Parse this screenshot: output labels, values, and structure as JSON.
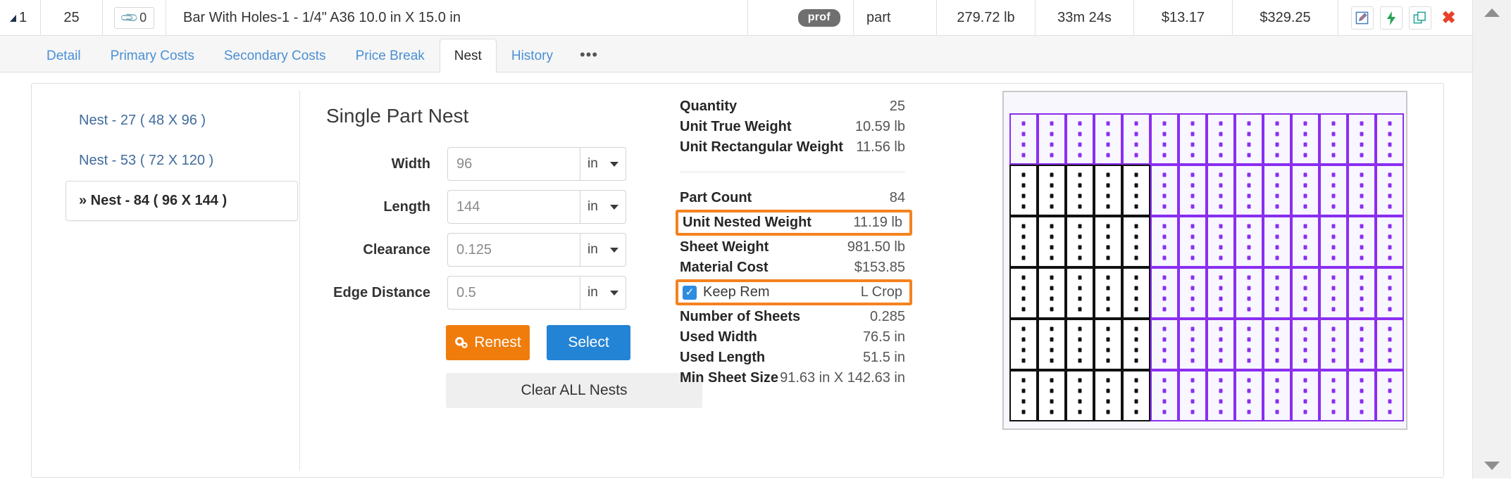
{
  "header_row": {
    "expand_icon": "caret-triangle-icon",
    "seq": "1",
    "qty": "25",
    "attachment_icon": "paperclip-icon",
    "attachment_count": "0",
    "description": "Bar With Holes-1 - 1/4\" A36 10.0 in X 15.0 in",
    "badge": "prof",
    "type": "part",
    "weight": "279.72 lb",
    "time": "33m 24s",
    "unit_cost": "$13.17",
    "total_cost": "$329.25",
    "actions": [
      {
        "name": "edit-icon",
        "glyph": "✎",
        "color": "#4a7fc1"
      },
      {
        "name": "lightning-bolt-icon",
        "glyph": "⚡",
        "color": "#23a455"
      },
      {
        "name": "duplicate-icon",
        "glyph": "⧉",
        "color": "#2fa89a"
      },
      {
        "name": "delete-icon",
        "glyph": "✖",
        "color": "#e8402a"
      }
    ]
  },
  "tabs": [
    {
      "label": "Detail",
      "active": false
    },
    {
      "label": "Primary Costs",
      "active": false
    },
    {
      "label": "Secondary Costs",
      "active": false
    },
    {
      "label": "Price Break",
      "active": false
    },
    {
      "label": "Nest",
      "active": true
    },
    {
      "label": "History",
      "active": false
    },
    {
      "label": "•••",
      "active": false
    }
  ],
  "nest_list": [
    {
      "label": "Nest - 27 ( 48 X 96 )",
      "selected": false
    },
    {
      "label": "Nest - 53 ( 72 X 120 )",
      "selected": false
    },
    {
      "label": "» Nest - 84 ( 96 X 144 )",
      "selected": true
    }
  ],
  "form": {
    "title": "Single Part Nest",
    "fields": [
      {
        "label": "Width",
        "value": "96",
        "unit": "in"
      },
      {
        "label": "Length",
        "value": "144",
        "unit": "in"
      },
      {
        "label": "Clearance",
        "value": "0.125",
        "unit": "in"
      },
      {
        "label": "Edge Distance",
        "value": "0.5",
        "unit": "in"
      }
    ],
    "renest_label": "Renest",
    "renest_icon": "gears-icon",
    "select_label": "Select",
    "clear_label": "Clear ALL Nests",
    "renest_color": "#f07c0b",
    "select_color": "#2383d4"
  },
  "stats": {
    "group1": [
      {
        "key": "Quantity",
        "value": "25"
      },
      {
        "key": "Unit True Weight",
        "value": "10.59 lb"
      },
      {
        "key": "Unit Rectangular Weight",
        "value": "11.56 lb"
      }
    ],
    "part_count": {
      "key": "Part Count",
      "value": "84"
    },
    "unit_nested_weight": {
      "key": "Unit Nested Weight",
      "value": "11.19 lb"
    },
    "sheet_weight": {
      "key": "Sheet Weight",
      "value": "981.50 lb"
    },
    "material_cost": {
      "key": "Material Cost",
      "value": "$153.85"
    },
    "keep_rem": {
      "label": "Keep Rem",
      "value": "L Crop",
      "checked": true
    },
    "group3": [
      {
        "key": "Number of Sheets",
        "value": "0.285"
      },
      {
        "key": "Used Width",
        "value": "76.5 in"
      },
      {
        "key": "Used Length",
        "value": "51.5 in"
      }
    ],
    "min_sheet_size": {
      "key": "Min Sheet Size",
      "value": "91.63 in X 142.63 in"
    },
    "highlight_color": "#f5821f"
  },
  "nest_diagram": {
    "columns": 14,
    "rows": 6,
    "holes_per_part": 4,
    "black_part_color": "#111111",
    "purple_part_color": "#8b2ef0",
    "sheet_bg": "#f7f7fd",
    "black_region": {
      "cols": [
        0,
        1,
        2,
        3,
        4
      ],
      "rows": [
        1,
        2,
        3,
        4,
        5
      ]
    }
  },
  "scrollbar": {
    "up": "scroll-up-arrow",
    "down": "scroll-down-arrow"
  }
}
